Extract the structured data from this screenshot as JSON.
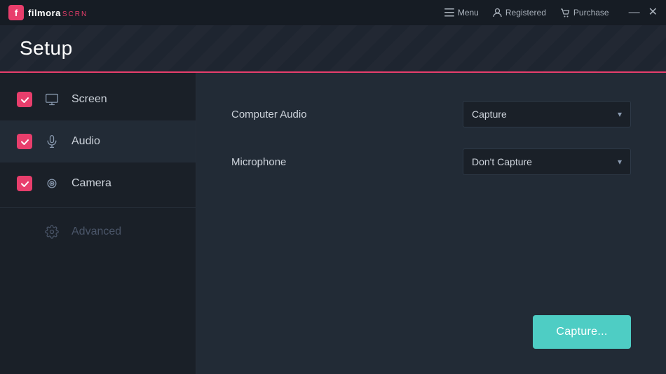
{
  "app": {
    "name": "filmora",
    "scrn": "scrn",
    "title": "Setup"
  },
  "titlebar": {
    "menu_label": "Menu",
    "registered_label": "Registered",
    "purchase_label": "Purchase",
    "minimize": "—",
    "close": "✕"
  },
  "sidebar": {
    "items": [
      {
        "id": "screen",
        "label": "Screen",
        "checked": true,
        "active": false,
        "disabled": false
      },
      {
        "id": "audio",
        "label": "Audio",
        "checked": true,
        "active": true,
        "disabled": false
      },
      {
        "id": "camera",
        "label": "Camera",
        "checked": true,
        "active": false,
        "disabled": false
      },
      {
        "id": "advanced",
        "label": "Advanced",
        "checked": false,
        "active": false,
        "disabled": true
      }
    ]
  },
  "content": {
    "computer_audio_label": "Computer Audio",
    "computer_audio_value": "Capture",
    "microphone_label": "Microphone",
    "microphone_value": "Don't Capture",
    "capture_button": "Capture..."
  }
}
